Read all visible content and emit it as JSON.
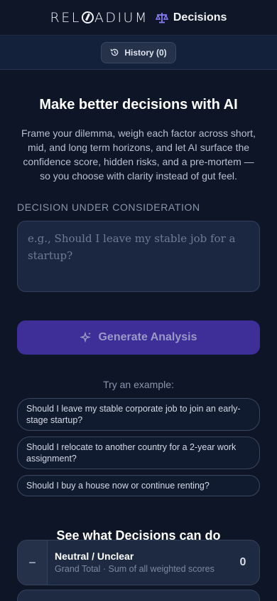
{
  "header": {
    "logo_text": "RELOADIUM",
    "app_name": "Decisions",
    "logo_icon": "scale-icon"
  },
  "history": {
    "label": "History (0)",
    "icon": "history-icon"
  },
  "hero": {
    "title": "Make better decisions with AI",
    "description": "Frame your dilemma, weigh each factor across short, mid, and long term horizons, and let AI surface the confidence score, hidden risks, and a pre-mortem — so you choose with clarity instead of gut feel."
  },
  "form": {
    "label": "DECISION UNDER CONSIDERATION",
    "placeholder": "e.g., Should I leave my stable job for a startup?",
    "generate_label": "Generate Analysis",
    "generate_icon": "sparkle-icon"
  },
  "examples": {
    "heading": "Try an example:",
    "items": [
      "Should I leave my stable corporate job to join an early-stage startup?",
      "Should I relocate to another country for a 2-year work assignment?",
      "Should I buy a house now or continue renting?"
    ]
  },
  "showcase": {
    "heading": "See what Decisions can do",
    "card": {
      "symbol": "−",
      "title": "Neutral / Unclear",
      "subtitle": "Grand Total · Sum of all weighted scores",
      "score": "0"
    }
  },
  "colors": {
    "accent": "#3d2e98",
    "background": "#0d1526",
    "scale_icon": "#8b7cf6"
  }
}
